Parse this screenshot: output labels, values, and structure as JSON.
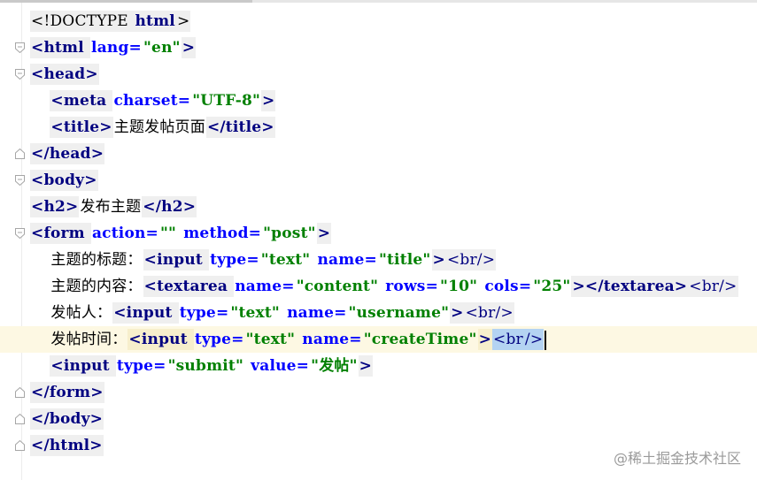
{
  "editor": {
    "lines": [
      {
        "fold": "none",
        "indent": "",
        "segments": [
          {
            "t": "<!DOCTYPE ",
            "c": "doctype"
          },
          {
            "t": "html",
            "c": "tag"
          },
          {
            "t": ">",
            "c": "doctype"
          }
        ]
      },
      {
        "fold": "open",
        "indent": "",
        "segments": [
          {
            "t": "<html ",
            "c": "tag"
          },
          {
            "t": "lang=",
            "c": "attr"
          },
          {
            "t": "\"en\"",
            "c": "val"
          },
          {
            "t": ">",
            "c": "tag"
          }
        ]
      },
      {
        "fold": "open",
        "indent": "",
        "segments": [
          {
            "t": "<head>",
            "c": "tag"
          }
        ]
      },
      {
        "fold": "none",
        "indent": "    ",
        "segments": [
          {
            "t": "<meta ",
            "c": "tag"
          },
          {
            "t": "charset=",
            "c": "attr"
          },
          {
            "t": "\"UTF-8\"",
            "c": "val"
          },
          {
            "t": ">",
            "c": "tag"
          }
        ]
      },
      {
        "fold": "none",
        "indent": "    ",
        "segments": [
          {
            "t": "<title>",
            "c": "tag"
          },
          {
            "t": "主题发帖页面",
            "c": "text"
          },
          {
            "t": "</title>",
            "c": "tag"
          }
        ]
      },
      {
        "fold": "close",
        "indent": "",
        "segments": [
          {
            "t": "</head>",
            "c": "tag"
          }
        ]
      },
      {
        "fold": "open",
        "indent": "",
        "segments": [
          {
            "t": "<body>",
            "c": "tag"
          }
        ]
      },
      {
        "fold": "none",
        "indent": "",
        "segments": [
          {
            "t": "<h2>",
            "c": "tag"
          },
          {
            "t": "发布主题",
            "c": "text"
          },
          {
            "t": "</h2>",
            "c": "tag"
          }
        ]
      },
      {
        "fold": "open",
        "indent": "",
        "segments": [
          {
            "t": "<form ",
            "c": "tag"
          },
          {
            "t": "action=",
            "c": "attr"
          },
          {
            "t": "\"\" ",
            "c": "val"
          },
          {
            "t": "method=",
            "c": "attr"
          },
          {
            "t": "\"post\"",
            "c": "val"
          },
          {
            "t": ">",
            "c": "tag"
          }
        ]
      },
      {
        "fold": "none",
        "indent": "    ",
        "segments": [
          {
            "t": "主题的标题：",
            "c": "text"
          },
          {
            "t": "<input ",
            "c": "tag"
          },
          {
            "t": "type=",
            "c": "attr"
          },
          {
            "t": "\"text\" ",
            "c": "val"
          },
          {
            "t": "name=",
            "c": "attr"
          },
          {
            "t": "\"title\"",
            "c": "val"
          },
          {
            "t": ">",
            "c": "tag"
          },
          {
            "t": "<br/>",
            "c": "br"
          }
        ]
      },
      {
        "fold": "none",
        "indent": "    ",
        "segments": [
          {
            "t": "主题的内容：",
            "c": "text"
          },
          {
            "t": "<textarea ",
            "c": "tag"
          },
          {
            "t": "name=",
            "c": "attr"
          },
          {
            "t": "\"content\" ",
            "c": "val"
          },
          {
            "t": "rows=",
            "c": "attr"
          },
          {
            "t": "\"10\" ",
            "c": "val"
          },
          {
            "t": "cols=",
            "c": "attr"
          },
          {
            "t": "\"25\"",
            "c": "val"
          },
          {
            "t": "></textarea>",
            "c": "tag"
          },
          {
            "t": "<br/>",
            "c": "br"
          }
        ]
      },
      {
        "fold": "none",
        "indent": "    ",
        "segments": [
          {
            "t": "发帖人：",
            "c": "text"
          },
          {
            "t": "<input ",
            "c": "tag"
          },
          {
            "t": "type=",
            "c": "attr"
          },
          {
            "t": "\"text\" ",
            "c": "val"
          },
          {
            "t": "name=",
            "c": "attr"
          },
          {
            "t": "\"username\"",
            "c": "val"
          },
          {
            "t": ">",
            "c": "tag"
          },
          {
            "t": "<br/>",
            "c": "br"
          }
        ]
      },
      {
        "fold": "none",
        "indent": "    ",
        "current": true,
        "segments": [
          {
            "t": "发帖时间：",
            "c": "text"
          },
          {
            "t": "<input ",
            "c": "tag",
            "hl": "a"
          },
          {
            "t": "type=",
            "c": "attr"
          },
          {
            "t": "\"text\" ",
            "c": "val"
          },
          {
            "t": "name=",
            "c": "attr"
          },
          {
            "t": "\"createTime\"",
            "c": "val"
          },
          {
            "t": ">",
            "c": "tag",
            "hl": "a"
          },
          {
            "t": "<br",
            "c": "br",
            "hl": "b"
          },
          {
            "t": "/>",
            "c": "br",
            "hl": "b",
            "caret": true
          }
        ]
      },
      {
        "fold": "none",
        "indent": "    ",
        "segments": [
          {
            "t": "<input ",
            "c": "tag"
          },
          {
            "t": "type=",
            "c": "attr"
          },
          {
            "t": "\"submit\" ",
            "c": "val"
          },
          {
            "t": "value=",
            "c": "attr"
          },
          {
            "t": "\"发帖\"",
            "c": "val"
          },
          {
            "t": ">",
            "c": "tag"
          }
        ]
      },
      {
        "fold": "close",
        "indent": "",
        "segments": [
          {
            "t": "</form>",
            "c": "tag"
          }
        ]
      },
      {
        "fold": "close",
        "indent": "",
        "segments": [
          {
            "t": "</body>",
            "c": "tag"
          }
        ]
      },
      {
        "fold": "close",
        "indent": "",
        "segments": [
          {
            "t": "</html>",
            "c": "tag"
          }
        ]
      }
    ]
  },
  "watermark": "@稀土掘金技术社区",
  "colors": {
    "tag": "#000080",
    "attr": "#0000ff",
    "value": "#008000",
    "text": "#000000",
    "current_line": "#fdf8e3",
    "tag_background": "#efefef",
    "selection": "#b4d3f2"
  }
}
